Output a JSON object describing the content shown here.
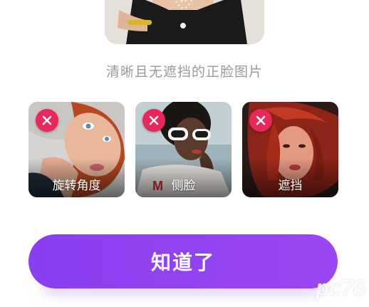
{
  "example": {
    "good_photo_icon": "portrait-photo",
    "caption": "清晰且无遮挡的正脸图片"
  },
  "samples": [
    {
      "label": "旋转角度",
      "icon": "close-icon"
    },
    {
      "label": "侧脸",
      "icon": "close-icon"
    },
    {
      "label": "遮挡",
      "icon": "close-icon"
    }
  ],
  "confirm": {
    "label": "知道了"
  },
  "colors": {
    "accent": "#9b46f5",
    "reject_badge": "#e8275a",
    "caption_text": "#9a9a9a"
  },
  "watermark": "pc76"
}
